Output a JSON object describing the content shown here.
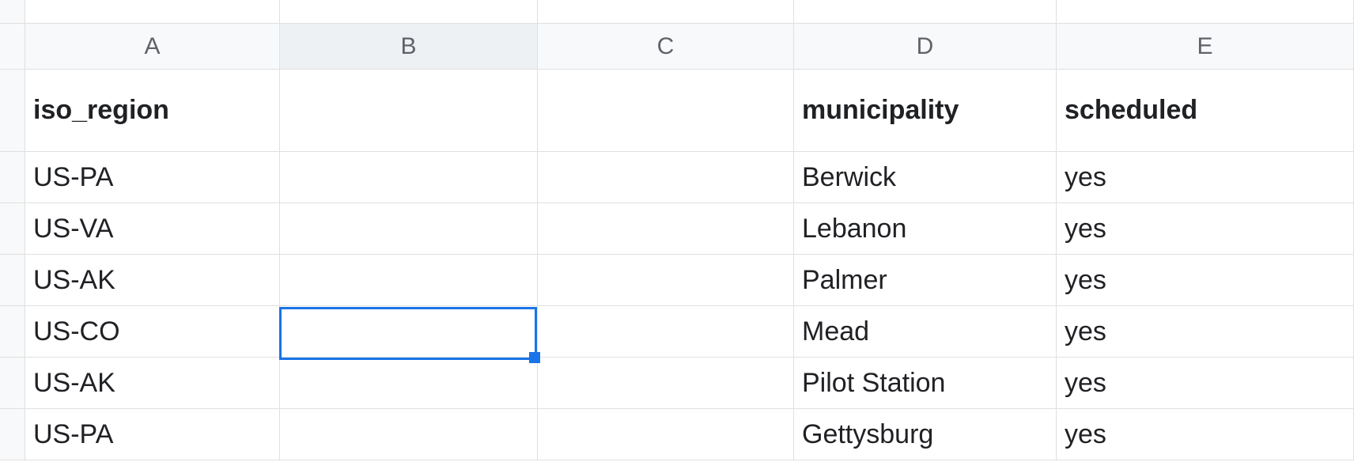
{
  "columns": [
    "A",
    "B",
    "C",
    "D",
    "E"
  ],
  "headers": {
    "A": "iso_region",
    "B": "",
    "C": "",
    "D": "municipality",
    "E": "scheduled"
  },
  "rows": [
    {
      "A": "US-PA",
      "B": "",
      "C": "",
      "D": "Berwick",
      "E": "yes"
    },
    {
      "A": "US-VA",
      "B": "",
      "C": "",
      "D": "Lebanon",
      "E": "yes"
    },
    {
      "A": "US-AK",
      "B": "",
      "C": "",
      "D": "Palmer",
      "E": "yes"
    },
    {
      "A": "US-CO",
      "B": "",
      "C": "",
      "D": "Mead",
      "E": "yes"
    },
    {
      "A": "US-AK",
      "B": "",
      "C": "",
      "D": "Pilot Station",
      "E": "yes"
    },
    {
      "A": "US-PA",
      "B": "",
      "C": "",
      "D": "Gettysburg",
      "E": "yes"
    }
  ],
  "selection": {
    "col": "B",
    "rowIndex": 3
  }
}
